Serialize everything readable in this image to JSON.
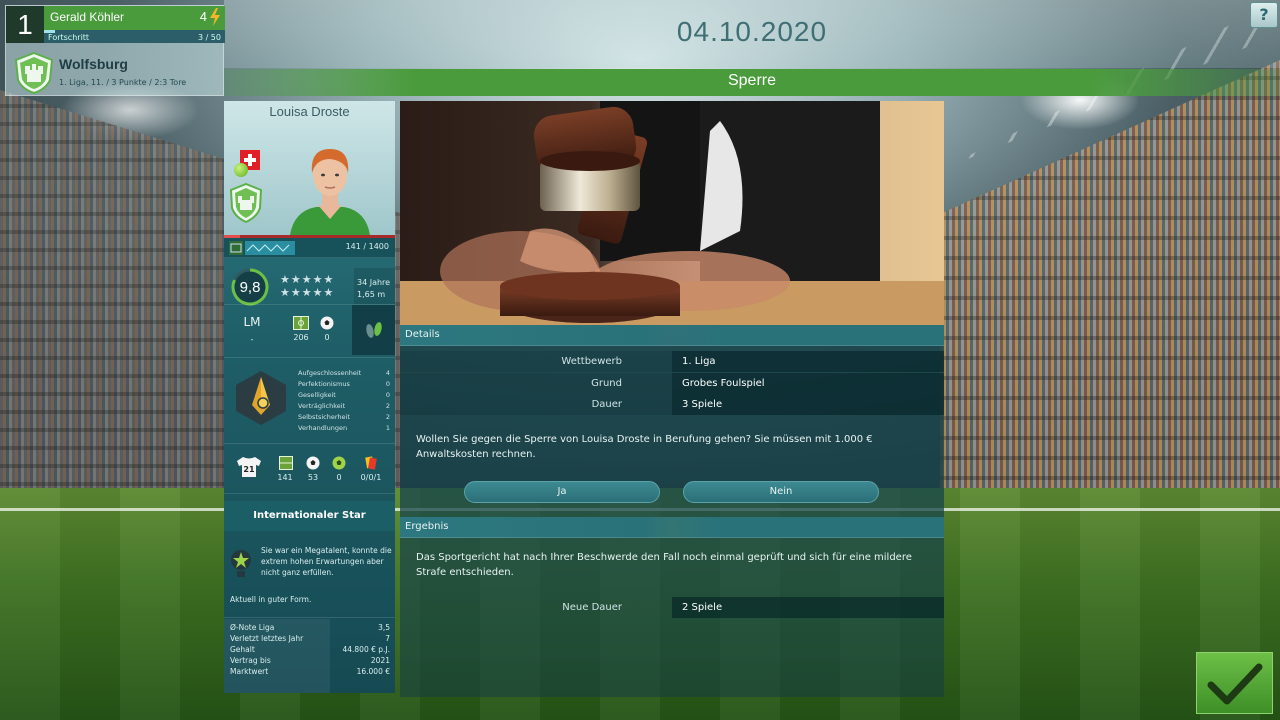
{
  "header": {
    "date": "04.10.2020",
    "title": "Sperre",
    "help_label": "?"
  },
  "manager": {
    "rank": "1",
    "name": "Gerald Köhler",
    "level": "4",
    "progress_label": "Fortschritt",
    "progress_value": "3 / 50",
    "progress_fraction": 0.06,
    "club": "Wolfsburg",
    "club_stats": "1. Liga, 11. / 3 Punkte / 2:3 Tore"
  },
  "player": {
    "name": "Louisa Droste",
    "xp": "141 / 1400",
    "rating": "9,8",
    "stars": "★★★★★",
    "stars_row2": "★★★★★",
    "age": "34 Jahre",
    "height": "1,65 m",
    "position": "LM",
    "position_sub": "-",
    "apps": "206",
    "goals": "0",
    "traits": [
      {
        "label": "Aufgeschlossenheit",
        "value": "4"
      },
      {
        "label": "Perfektionismus",
        "value": "0"
      },
      {
        "label": "Geselligkeit",
        "value": "0"
      },
      {
        "label": "Verträglichkeit",
        "value": "2"
      },
      {
        "label": "Selbstsicherheit",
        "value": "2"
      },
      {
        "label": "Verhandlungen",
        "value": "1"
      }
    ],
    "shirt_number": "21",
    "season_stats": [
      "141",
      "53",
      "0",
      "0/0/1"
    ],
    "star_title": "Internationaler Star",
    "star_desc": "Sie war ein Megatalent, konnte die extrem hohen Erwartungen aber nicht ganz erfüllen.",
    "form": "Aktuell in guter Form.",
    "facts": [
      {
        "label": "Ø-Note Liga",
        "value": "3,5"
      },
      {
        "label": "Verletzt letztes Jahr",
        "value": "7"
      },
      {
        "label": "Gehalt",
        "value": "44.800 € p.J."
      },
      {
        "label": "Vertrag bis",
        "value": "2021"
      },
      {
        "label": "Marktwert",
        "value": "16.000 €"
      }
    ]
  },
  "details": {
    "heading": "Details",
    "rows": [
      {
        "label": "Wettbewerb",
        "value": "1. Liga"
      },
      {
        "label": "Grund",
        "value": "Grobes Foulspiel"
      },
      {
        "label": "Dauer",
        "value": "3 Spiele"
      }
    ],
    "question": "Wollen Sie gegen die Sperre von Louisa Droste in Berufung gehen? Sie müssen mit 1.000 € Anwaltskosten rechnen.",
    "yes_label": "Ja",
    "no_label": "Nein"
  },
  "result": {
    "heading": "Ergebnis",
    "text": "Das Sportgericht hat nach Ihrer Beschwerde den Fall noch einmal geprüft und sich für eine mildere Strafe entschieden.",
    "new_label": "Neue Dauer",
    "new_value": "2 Spiele"
  },
  "icons": {
    "help": "question-icon",
    "confirm": "check-icon",
    "level": "bolt-icon"
  },
  "colors": {
    "accent_green": "#4a9b3c",
    "panel_teal": "#1f5f68"
  }
}
